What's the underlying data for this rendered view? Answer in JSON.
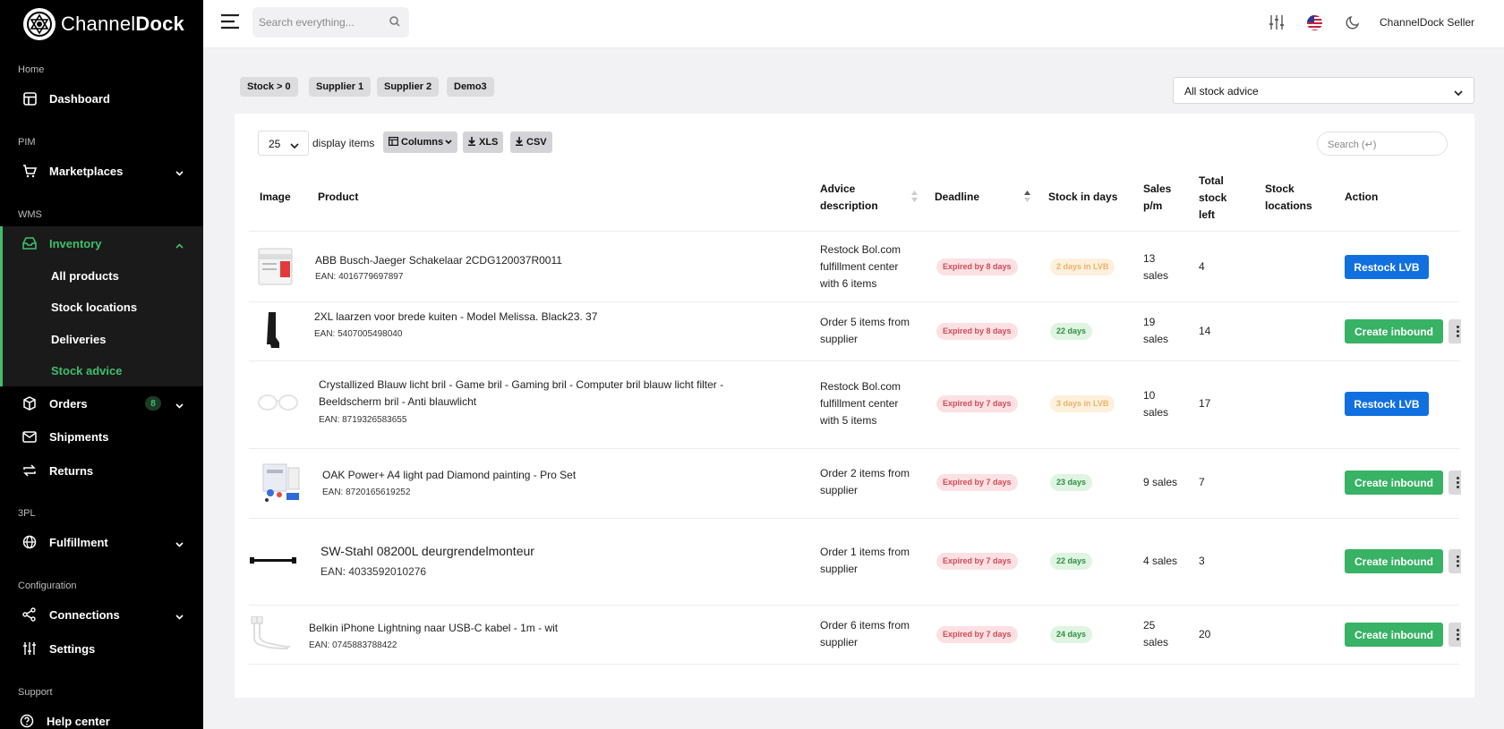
{
  "app": {
    "brand_light": "Channel",
    "brand_bold": "Dock"
  },
  "colors": {
    "accent_green": "#3fbf6c",
    "button_blue": "#1170e0",
    "button_green": "#38b264",
    "expired_red": "#d24a58"
  },
  "sidebar": {
    "sections": {
      "home": "Home",
      "pim": "PIM",
      "wms": "WMS",
      "pl3": "3PL",
      "configuration": "Configuration",
      "support": "Support"
    },
    "items": {
      "dashboard": "Dashboard",
      "marketplaces": "Marketplaces",
      "inventory": "Inventory",
      "orders": "Orders",
      "orders_badge": "8",
      "shipments": "Shipments",
      "returns": "Returns",
      "fulfillment": "Fulfillment",
      "connections": "Connections",
      "settings": "Settings",
      "help_center": "Help center"
    },
    "inventory_sub": [
      "All products",
      "Stock locations",
      "Deliveries",
      "Stock advice"
    ]
  },
  "topbar": {
    "search_placeholder": "Search everything...",
    "user": "ChannelDock Seller"
  },
  "filters": {
    "chips": [
      "Stock > 0",
      "Supplier 1",
      "Supplier 2",
      "Demo3"
    ],
    "advice_select": "All stock advice"
  },
  "table_controls": {
    "page_size": "25",
    "display_label": "display items",
    "columns_btn": "Columns",
    "xls_btn": "XLS",
    "csv_btn": "CSV",
    "search_placeholder": "Search (↵)"
  },
  "columns": {
    "image": "Image",
    "product": "Product",
    "advice_l1": "Advice",
    "advice_l2": "description",
    "deadline": "Deadline",
    "stock_days": "Stock in days",
    "sales_l1": "Sales",
    "sales_l2": "p/m",
    "total_l1": "Total",
    "total_l2": "stock",
    "total_l3": "left",
    "locations_l1": "Stock",
    "locations_l2": "locations",
    "action": "Action"
  },
  "rows": [
    {
      "name": "ABB Busch-Jaeger Schakelaar 2CDG120037R0011",
      "ean": "EAN: 4016779697897",
      "advice": [
        "Restock Bol.com",
        "fulfillment center",
        "with 6 items"
      ],
      "deadline": "Expired by 8 days",
      "stock_days": "2 days in LVB",
      "sales": [
        "13",
        "sales"
      ],
      "total": "4",
      "action": "Restock LVB"
    },
    {
      "name": "2XL laarzen voor brede kuiten - Model Melissa. Black23. 37",
      "ean": "EAN: 5407005498040",
      "advice": [
        "Order 5 items from",
        "supplier"
      ],
      "deadline": "Expired by 8 days",
      "stock_days": "22 days",
      "sales": [
        "19",
        "sales"
      ],
      "total": "14",
      "action": "Create inbound"
    },
    {
      "name_l1": "Crystallized Blauw licht bril - Game bril - Gaming bril - Computer bril blauw licht filter -",
      "name_l2": "Beeldscherm bril - Anti blauwlicht",
      "ean": "EAN: 8719326583655",
      "advice": [
        "Restock Bol.com",
        "fulfillment center",
        "with 5 items"
      ],
      "deadline": "Expired by 7 days",
      "stock_days": "3 days in LVB",
      "sales": [
        "10",
        "sales"
      ],
      "total": "17",
      "action": "Restock LVB"
    },
    {
      "name": "OAK Power+ A4 light pad Diamond painting - Pro Set",
      "ean": "EAN: 8720165619252",
      "advice": [
        "Order 2 items from",
        "supplier"
      ],
      "deadline": "Expired by 7 days",
      "stock_days": "23 days",
      "sales": [
        "9 sales"
      ],
      "total": "7",
      "action": "Create inbound"
    },
    {
      "name": "SW-Stahl 08200L deurgrendelmonteur",
      "ean": "EAN: 4033592010276",
      "advice": [
        "Order 1 items from",
        "supplier"
      ],
      "deadline": "Expired by 7 days",
      "stock_days": "22 days",
      "sales": [
        "4 sales"
      ],
      "total": "3",
      "action": "Create inbound"
    },
    {
      "name": "Belkin iPhone Lightning naar USB-C kabel - 1m - wit",
      "ean": "EAN: 0745883788422",
      "advice": [
        "Order 6 items from",
        "supplier"
      ],
      "deadline": "Expired by 7 days",
      "stock_days": "24 days",
      "sales": [
        "25",
        "sales"
      ],
      "total": "20",
      "action": "Create inbound"
    }
  ]
}
